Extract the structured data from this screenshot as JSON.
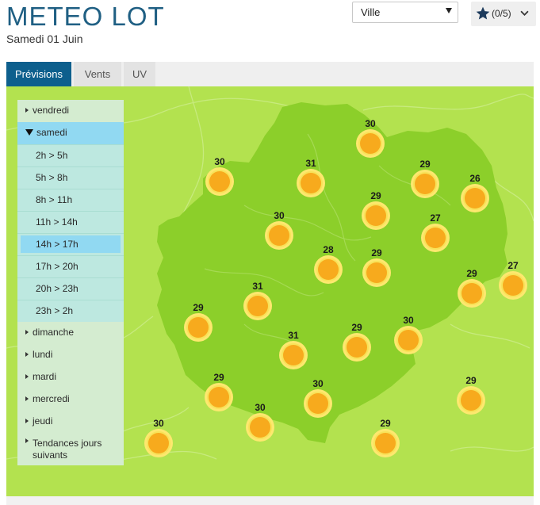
{
  "header": {
    "title": "METEO LOT",
    "date": "Samedi 01 Juin",
    "city_select": {
      "selected": "Ville"
    },
    "favorites": {
      "count": "(0/5)"
    }
  },
  "tabs": [
    {
      "label": "Prévisions",
      "active": true
    },
    {
      "label": "Vents",
      "active": false
    },
    {
      "label": "UV",
      "active": false
    }
  ],
  "sidebar": {
    "days_before": [
      {
        "label": "vendredi"
      }
    ],
    "open_day": {
      "label": "samedi"
    },
    "slots": [
      {
        "label": "2h > 5h",
        "selected": false
      },
      {
        "label": "5h > 8h",
        "selected": false
      },
      {
        "label": "8h > 11h",
        "selected": false
      },
      {
        "label": "11h > 14h",
        "selected": false
      },
      {
        "label": "14h > 17h",
        "selected": true
      },
      {
        "label": "17h > 20h",
        "selected": false
      },
      {
        "label": "20h > 23h",
        "selected": false
      },
      {
        "label": "23h > 2h",
        "selected": false
      }
    ],
    "days_after": [
      {
        "label": "dimanche"
      },
      {
        "label": "lundi"
      },
      {
        "label": "mardi"
      },
      {
        "label": "mercredi"
      },
      {
        "label": "jeudi"
      }
    ],
    "tendances": "Tendances jours suivants"
  },
  "map": {
    "weather_icon": "sun-icon",
    "colors": {
      "background": "#b3e24f",
      "department": "#8ccf2a",
      "sun": "#f7aa1d"
    },
    "markers": [
      {
        "temp": "30"
      },
      {
        "temp": "30"
      },
      {
        "temp": "31"
      },
      {
        "temp": "29"
      },
      {
        "temp": "26"
      },
      {
        "temp": "29"
      },
      {
        "temp": "30"
      },
      {
        "temp": "27"
      },
      {
        "temp": "28"
      },
      {
        "temp": "29"
      },
      {
        "temp": "29"
      },
      {
        "temp": "27"
      },
      {
        "temp": "31"
      },
      {
        "temp": "29"
      },
      {
        "temp": "31"
      },
      {
        "temp": "29"
      },
      {
        "temp": "30"
      },
      {
        "temp": "29"
      },
      {
        "temp": "30"
      },
      {
        "temp": "29"
      },
      {
        "temp": "30"
      },
      {
        "temp": "30"
      },
      {
        "temp": "29"
      }
    ]
  }
}
